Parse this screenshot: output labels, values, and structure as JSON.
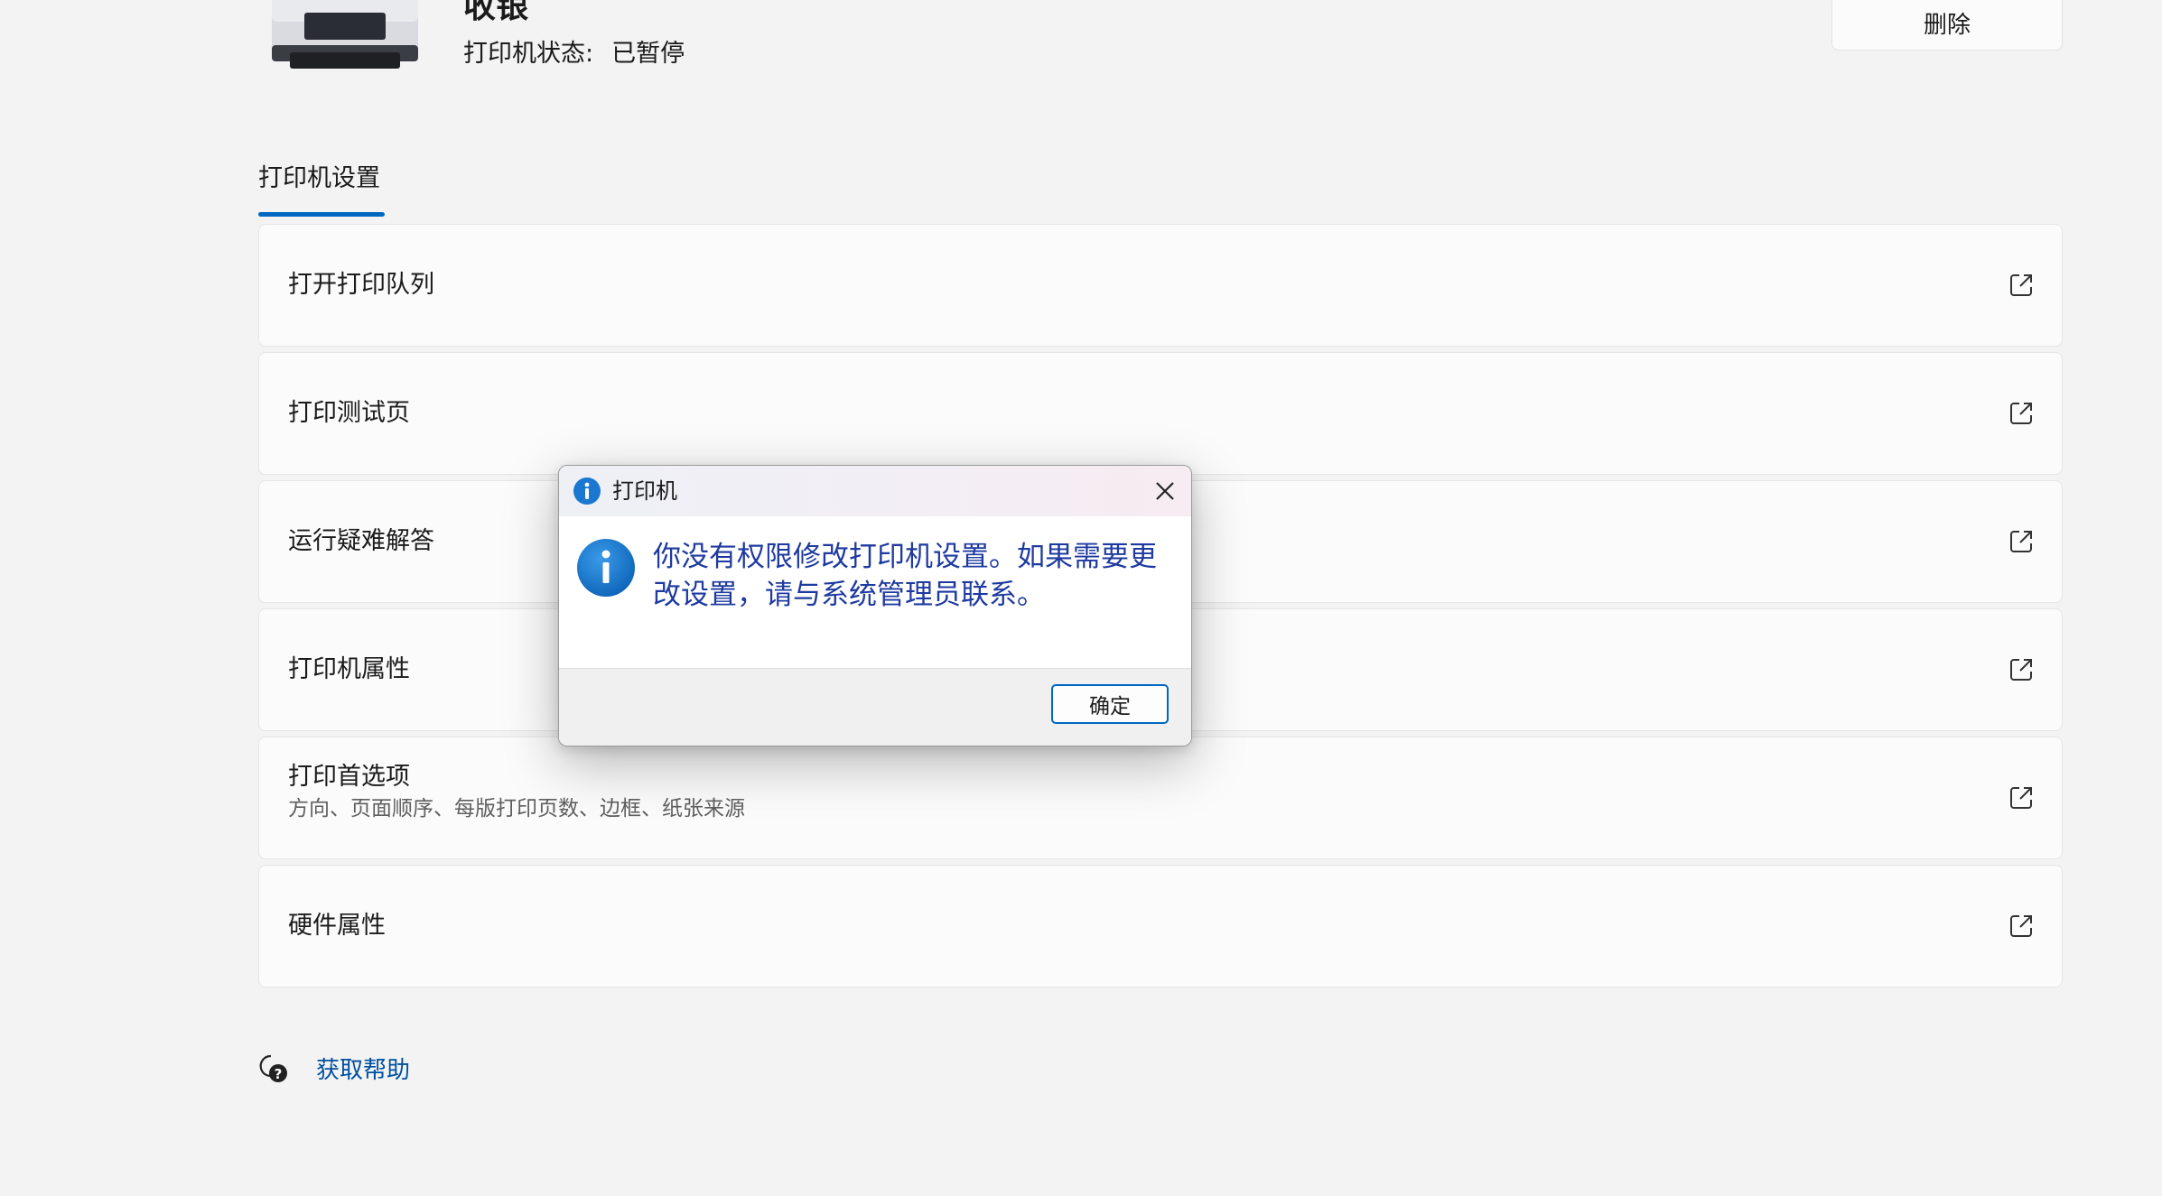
{
  "printer": {
    "name": "收银",
    "status_label": "打印机状态:",
    "status_value": "已暂停",
    "delete_label": "删除"
  },
  "section": {
    "tab_label": "打印机设置"
  },
  "rows": [
    {
      "label": "打开打印队列",
      "icon": "open-external-icon"
    },
    {
      "label": "打印测试页",
      "icon": "open-external-icon"
    },
    {
      "label": "运行疑难解答",
      "icon": "open-external-icon"
    },
    {
      "label": "打印机属性",
      "icon": "open-external-icon"
    },
    {
      "label": "打印首选项",
      "sublabel": "方向、页面顺序、每版打印页数、边框、纸张来源",
      "icon": "open-external-icon"
    },
    {
      "label": "硬件属性",
      "icon": "open-external-icon"
    }
  ],
  "help": {
    "label": "获取帮助",
    "icon": "help-chat-icon"
  },
  "dialog": {
    "title": "打印机",
    "message": "你没有权限修改打印机设置。如果需要更改设置，请与系统管理员联系。",
    "ok_label": "确定",
    "icon": "info-icon"
  },
  "colors": {
    "accent": "#0067c0",
    "message_text": "#1e3aa0",
    "info_icon": "#1a78d0"
  }
}
